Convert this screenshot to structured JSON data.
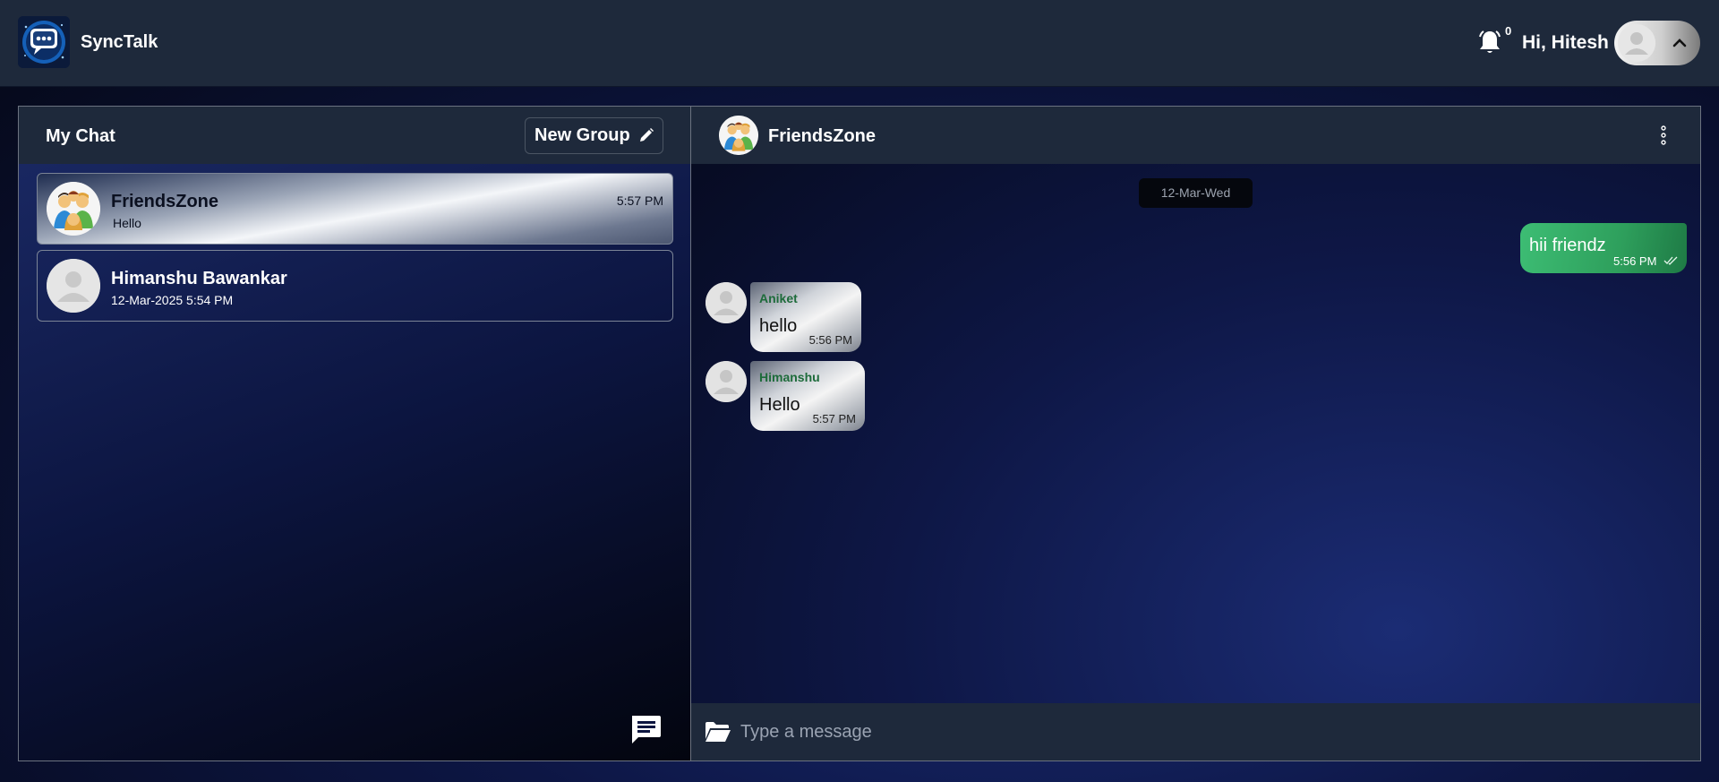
{
  "app": {
    "brand": "SyncTalk"
  },
  "header": {
    "notification_count": "0",
    "greeting": "Hi, Hitesh"
  },
  "sidebar": {
    "title": "My Chat",
    "new_group_label": "New Group",
    "chats": [
      {
        "name": "FriendsZone",
        "last_message": "Hello",
        "time": "5:57 PM",
        "active": true
      },
      {
        "name": "Himanshu Bawankar",
        "last_message": "12-Mar-2025 5:54 PM",
        "time": "",
        "active": false
      }
    ]
  },
  "conversation": {
    "title": "FriendsZone",
    "date_divider": "12-Mar-Wed",
    "messages": [
      {
        "direction": "out",
        "text": "hii friendz",
        "time": "5:56 PM",
        "status": "read"
      },
      {
        "direction": "in",
        "sender": "Aniket",
        "text": "hello",
        "time": "5:56 PM"
      },
      {
        "direction": "in",
        "sender": "Himanshu",
        "text": "Hello",
        "time": "5:57 PM"
      }
    ],
    "composer_placeholder": "Type a message"
  },
  "colors": {
    "header_bg": "#1e293b",
    "outgoing_bubble": "#3dbd74",
    "sender_name": "#1d6b3a"
  },
  "icons": [
    "app-logo",
    "bell-icon",
    "avatar-icon",
    "chevron-up-icon",
    "pencil-icon",
    "chat-icon",
    "kebab-menu-icon",
    "double-check-icon",
    "folder-open-icon"
  ]
}
